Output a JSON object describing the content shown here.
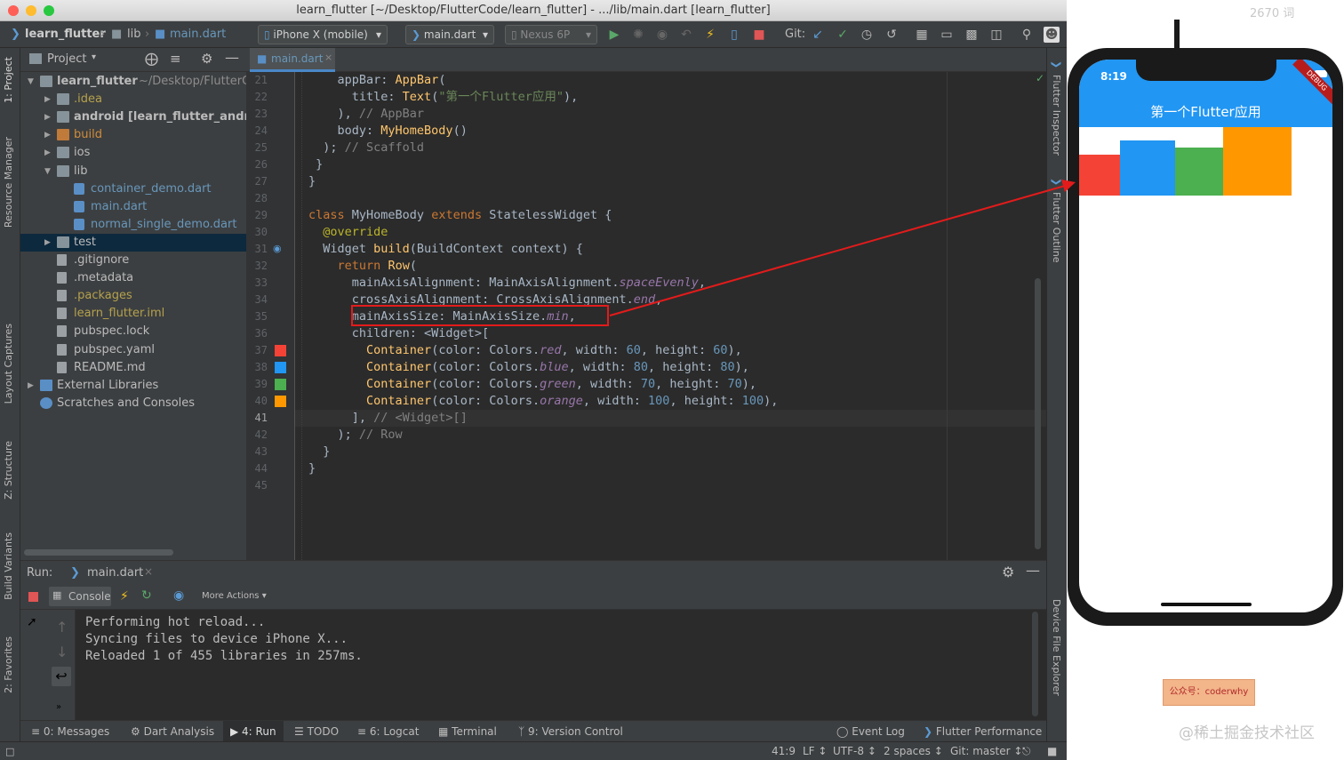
{
  "window": {
    "title": "learn_flutter [~/Desktop/FlutterCode/learn_flutter] - .../lib/main.dart [learn_flutter]"
  },
  "toolbar": {
    "breadcrumb_project": "learn_flutter",
    "breadcrumb_folder": "lib",
    "breadcrumb_file": "main.dart",
    "device_select": "iPhone X (mobile)",
    "run_config": "main.dart",
    "avd": "Nexus 6P",
    "git_label": "Git:"
  },
  "left_stripe": {
    "project": "1: Project",
    "resource_manager": "Resource Manager",
    "layout_captures": "Layout Captures",
    "structure": "Z: Structure",
    "build_variants": "Build Variants",
    "favorites": "2: Favorites"
  },
  "right_stripe": {
    "flutter_inspector": "Flutter Inspector",
    "flutter_outline": "Flutter Outline",
    "device_file_explorer": "Device File Explorer"
  },
  "project_panel": {
    "title": "Project",
    "tree": [
      {
        "label": "learn_flutter",
        "suffix": "~/Desktop/FlutterC",
        "depth": 0,
        "expanded": true,
        "kind": "folder",
        "color": "#bbbbbb",
        "bold": true
      },
      {
        "label": ".idea",
        "suffix": "",
        "depth": 1,
        "expanded": false,
        "kind": "folder",
        "color": "#b5a14d",
        "bold": false
      },
      {
        "label": "android [learn_flutter_andro",
        "suffix": "",
        "depth": 1,
        "expanded": false,
        "kind": "folder",
        "color": "#bbbbbb",
        "bold": true
      },
      {
        "label": "build",
        "suffix": "",
        "depth": 1,
        "expanded": false,
        "kind": "folder",
        "color": "#d08c3c",
        "bold": false
      },
      {
        "label": "ios",
        "suffix": "",
        "depth": 1,
        "expanded": false,
        "kind": "folder",
        "color": "#bbbbbb",
        "bold": false
      },
      {
        "label": "lib",
        "suffix": "",
        "depth": 1,
        "expanded": true,
        "kind": "folder",
        "color": "#bbbbbb",
        "bold": false
      },
      {
        "label": "container_demo.dart",
        "suffix": "",
        "depth": 2,
        "expanded": null,
        "kind": "dart",
        "color": "#6897bb",
        "bold": false
      },
      {
        "label": "main.dart",
        "suffix": "",
        "depth": 2,
        "expanded": null,
        "kind": "dart",
        "color": "#6897bb",
        "bold": false
      },
      {
        "label": "normal_single_demo.dart",
        "suffix": "",
        "depth": 2,
        "expanded": null,
        "kind": "dart",
        "color": "#6897bb",
        "bold": false
      },
      {
        "label": "test",
        "suffix": "",
        "depth": 1,
        "expanded": false,
        "kind": "folder",
        "color": "#bbbbbb",
        "bold": false,
        "selected": true
      },
      {
        "label": ".gitignore",
        "suffix": "",
        "depth": 1,
        "expanded": null,
        "kind": "file",
        "color": "#bbbbbb",
        "bold": false
      },
      {
        "label": ".metadata",
        "suffix": "",
        "depth": 1,
        "expanded": null,
        "kind": "file",
        "color": "#bbbbbb",
        "bold": false
      },
      {
        "label": ".packages",
        "suffix": "",
        "depth": 1,
        "expanded": null,
        "kind": "file",
        "color": "#b5a14d",
        "bold": false
      },
      {
        "label": "learn_flutter.iml",
        "suffix": "",
        "depth": 1,
        "expanded": null,
        "kind": "file",
        "color": "#b5a14d",
        "bold": false
      },
      {
        "label": "pubspec.lock",
        "suffix": "",
        "depth": 1,
        "expanded": null,
        "kind": "file",
        "color": "#bbbbbb",
        "bold": false
      },
      {
        "label": "pubspec.yaml",
        "suffix": "",
        "depth": 1,
        "expanded": null,
        "kind": "file",
        "color": "#bbbbbb",
        "bold": false
      },
      {
        "label": "README.md",
        "suffix": "",
        "depth": 1,
        "expanded": null,
        "kind": "file",
        "color": "#bbbbbb",
        "bold": false
      },
      {
        "label": "External Libraries",
        "suffix": "",
        "depth": 0,
        "expanded": false,
        "kind": "libs",
        "color": "#bbbbbb",
        "bold": false
      },
      {
        "label": "Scratches and Consoles",
        "suffix": "",
        "depth": 0,
        "expanded": null,
        "kind": "scratch",
        "color": "#bbbbbb",
        "bold": false
      }
    ]
  },
  "editor": {
    "tab": "main.dart",
    "lines": [
      {
        "n": "21",
        "html": "    appBar: <span class=\"cls\">AppBar</span>("
      },
      {
        "n": "22",
        "html": "      title: <span class=\"cls\">Text</span>(<span class=\"str\">\"第一个Flutter应用\"</span>),"
      },
      {
        "n": "23",
        "html": "    ), <span class=\"cm\">// AppBar</span>"
      },
      {
        "n": "24",
        "html": "    body: <span class=\"cls\">MyHomeBody</span>()"
      },
      {
        "n": "25",
        "html": "  ); <span class=\"cm\">// Scaffold</span>"
      },
      {
        "n": "26",
        "html": " }"
      },
      {
        "n": "27",
        "html": "}"
      },
      {
        "n": "28",
        "html": ""
      },
      {
        "n": "29",
        "html": "<span class=\"kw\">class</span> MyHomeBody <span class=\"kw\">extends</span> StatelessWidget {"
      },
      {
        "n": "30",
        "html": "  <span class=\"ann\">@override</span>"
      },
      {
        "n": "31",
        "html": "  Widget <span class=\"cls\">build</span>(BuildContext context) {"
      },
      {
        "n": "32",
        "html": "    <span class=\"kw\">return</span> <span class=\"cls\">Row</span>("
      },
      {
        "n": "33",
        "html": "      mainAxisAlignment: MainAxisAlignment.<span class=\"prop\">spaceEvenly</span>,"
      },
      {
        "n": "34",
        "html": "      crossAxisAlignment: CrossAxisAlignment.<span class=\"prop\">end</span>,"
      },
      {
        "n": "35",
        "html": "      mainAxisSize: MainAxisSize.<span class=\"prop\">min</span>,"
      },
      {
        "n": "36",
        "html": "      children: &lt;Widget&gt;["
      },
      {
        "n": "37",
        "html": "        <span class=\"cls\">Container</span>(color: Colors.<span class=\"prop\">red</span>, width: <span class=\"num\">60</span>, height: <span class=\"num\">60</span>),"
      },
      {
        "n": "38",
        "html": "        <span class=\"cls\">Container</span>(color: Colors.<span class=\"prop\">blue</span>, width: <span class=\"num\">80</span>, height: <span class=\"num\">80</span>),"
      },
      {
        "n": "39",
        "html": "        <span class=\"cls\">Container</span>(color: Colors.<span class=\"prop\">green</span>, width: <span class=\"num\">70</span>, height: <span class=\"num\">70</span>),"
      },
      {
        "n": "40",
        "html": "        <span class=\"cls\">Container</span>(color: Colors.<span class=\"prop\">orange</span>, width: <span class=\"num\">100</span>, height: <span class=\"num\">100</span>),"
      },
      {
        "n": "41",
        "html": "      ], <span class=\"cm\">// &lt;Widget&gt;[]</span>"
      },
      {
        "n": "42",
        "html": "    ); <span class=\"cm\">// Row</span>"
      },
      {
        "n": "43",
        "html": "  }"
      },
      {
        "n": "44",
        "html": "}"
      },
      {
        "n": "45",
        "html": ""
      }
    ],
    "gutter_swatches": [
      "#f44336",
      "#2196f3",
      "#4caf50",
      "#ff9800"
    ]
  },
  "run_panel": {
    "label": "Run:",
    "tab": "main.dart",
    "console_tab": "Console",
    "more_actions": "More Actions",
    "console_lines": [
      "Performing hot reload...",
      "Syncing files to device iPhone X...",
      "Reloaded 1 of 455 libraries in 257ms."
    ]
  },
  "bottom_tabs": {
    "messages": "0: Messages",
    "dart_analysis": "Dart Analysis",
    "run": "4: Run",
    "todo": "TODO",
    "logcat": "6: Logcat",
    "terminal": "Terminal",
    "version_control": "9: Version Control",
    "event_log": "Event Log",
    "flutter_performance": "Flutter Performance"
  },
  "status_bar": {
    "position": "41:9",
    "line_sep": "LF",
    "encoding": "UTF-8",
    "indent": "2 spaces",
    "git": "Git: master"
  },
  "phone": {
    "time": "8:19",
    "app_title": "第一个Flutter应用",
    "debug_banner": "DEBUG",
    "row_boxes": [
      {
        "color": "#f44336",
        "width": 60,
        "height": 60
      },
      {
        "color": "#2196f3",
        "width": 80,
        "height": 80
      },
      {
        "color": "#4caf50",
        "width": 70,
        "height": 70
      },
      {
        "color": "#ff9800",
        "width": 100,
        "height": 100
      }
    ]
  },
  "overlay": {
    "word_count": "2670 词",
    "wechat_badge": "公众号：coderwhy",
    "watermark": "@稀土掘金技术社区"
  }
}
